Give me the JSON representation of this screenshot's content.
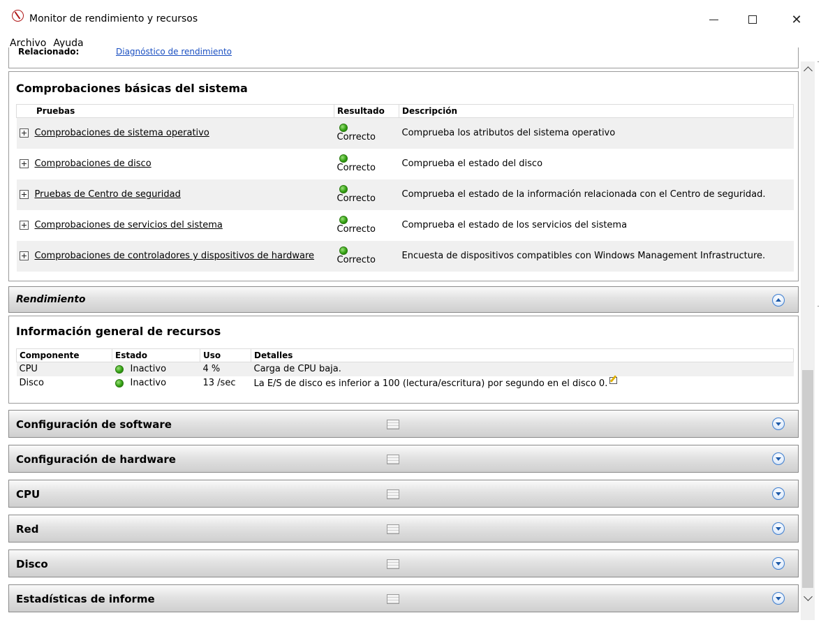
{
  "window": {
    "title": "Monitor de rendimiento y recursos",
    "minimize_glyph": "—",
    "close_glyph": "✕"
  },
  "menu": [
    "Archivo",
    "Ayuda"
  ],
  "related": {
    "label": "Relacionado:",
    "link": "Diagnóstico de rendimiento"
  },
  "basic_checks": {
    "heading": "Comprobaciones básicas del sistema",
    "columns": [
      "Pruebas",
      "Resultado",
      "Descripción"
    ],
    "rows": [
      {
        "test": "Comprobaciones de sistema operativo",
        "result": "Correcto",
        "description": "Comprueba los atributos del sistema operativo"
      },
      {
        "test": "Comprobaciones de disco",
        "result": "Correcto",
        "description": "Comprueba el estado del disco"
      },
      {
        "test": "Pruebas de Centro de seguridad",
        "result": "Correcto",
        "description": "Comprueba el estado de la información relacionada con el Centro de seguridad."
      },
      {
        "test": "Comprobaciones de servicios del sistema",
        "result": "Correcto",
        "description": "Comprueba el estado de los servicios del sistema"
      },
      {
        "test": "Comprobaciones de controladores y dispositivos de hardware",
        "result": "Correcto",
        "description": "Encuesta de dispositivos compatibles con Windows Management Infrastructure."
      }
    ]
  },
  "performance_band": {
    "title": "Rendimiento"
  },
  "resources": {
    "heading": "Información general de recursos",
    "columns": [
      "Componente",
      "Estado",
      "Uso",
      "Detalles"
    ],
    "rows": [
      {
        "component": "CPU",
        "state": "Inactivo",
        "usage": "4 %",
        "details": "Carga de CPU baja."
      },
      {
        "component": "Disco",
        "state": "Inactivo",
        "usage": "13 /sec",
        "details": "La E/S de disco es inferior a 100 (lectura/escritura) por segundo en el disco 0."
      }
    ]
  },
  "collapsed_sections": [
    {
      "title": "Configuración de software"
    },
    {
      "title": "Configuración de hardware"
    },
    {
      "title": "CPU"
    },
    {
      "title": "Red"
    },
    {
      "title": "Disco"
    },
    {
      "title": "Estadísticas de informe"
    }
  ],
  "colors": {
    "link": "#1a4fc1",
    "status_ok": "#35a314",
    "toggle_border": "#3f7fd0"
  }
}
